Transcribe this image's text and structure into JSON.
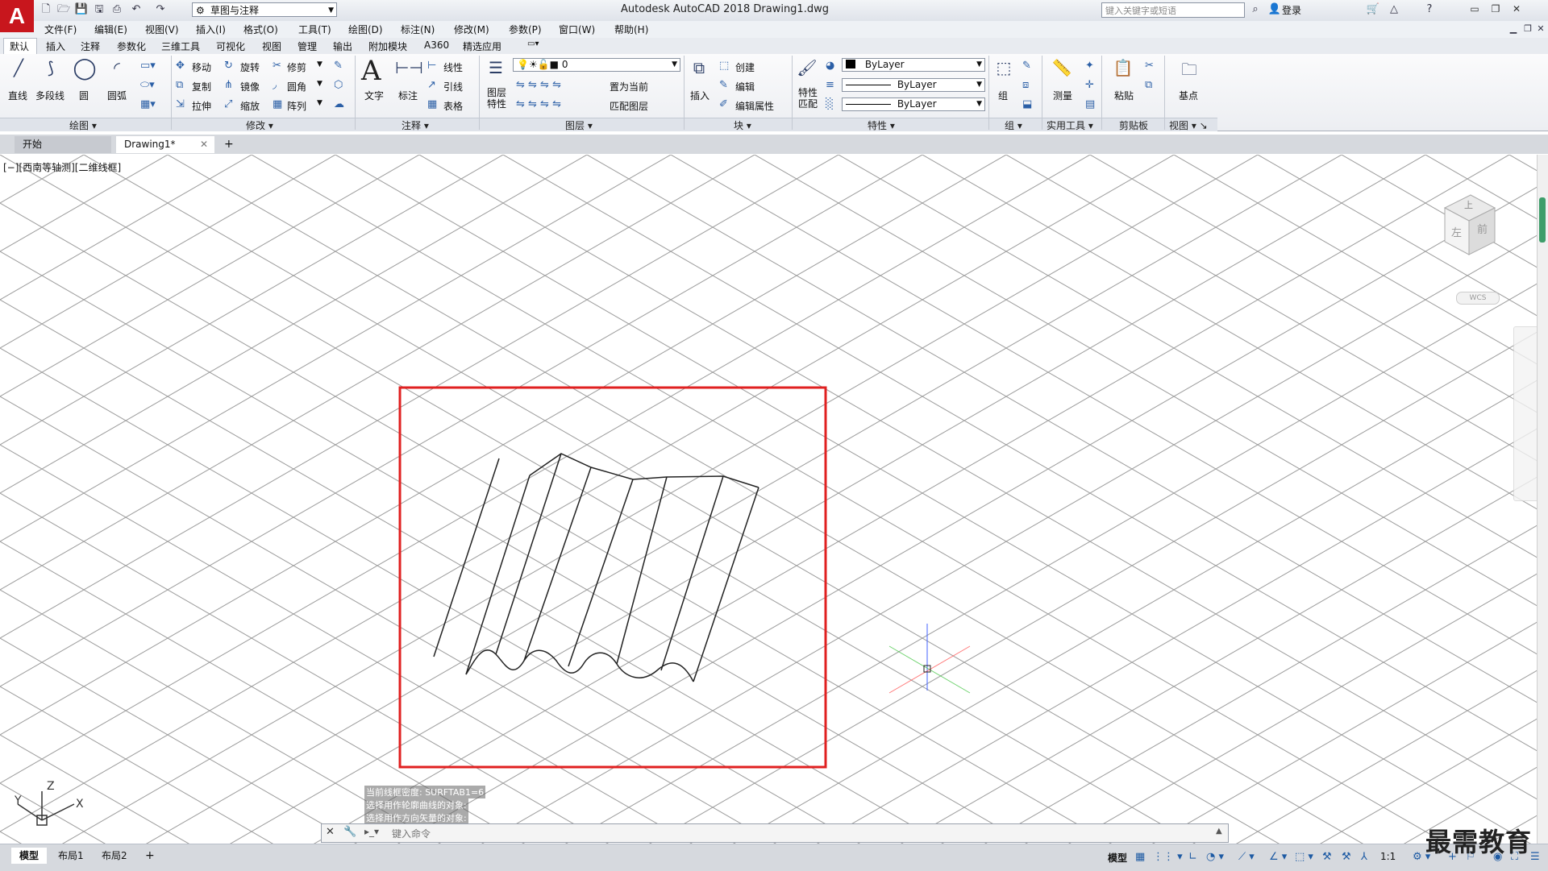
{
  "app": {
    "logo": "A",
    "title": "Autodesk AutoCAD 2018    Drawing1.dwg",
    "workspace": "草图与注释",
    "search_placeholder": "键入关键字或短语",
    "login": "登录"
  },
  "menu": [
    "文件(F)",
    "编辑(E)",
    "视图(V)",
    "插入(I)",
    "格式(O)",
    "工具(T)",
    "绘图(D)",
    "标注(N)",
    "修改(M)",
    "参数(P)",
    "窗口(W)",
    "帮助(H)"
  ],
  "ribbon_tabs": [
    "默认",
    "插入",
    "注释",
    "参数化",
    "三维工具",
    "可视化",
    "视图",
    "管理",
    "输出",
    "附加模块",
    "A360",
    "精选应用"
  ],
  "panels": {
    "draw": {
      "title": "绘图",
      "line": "直线",
      "polyline": "多段线",
      "circle": "圆",
      "arc": "圆弧"
    },
    "modify": {
      "title": "修改",
      "move": "移动",
      "rotate": "旋转",
      "trim": "修剪",
      "copy": "复制",
      "mirror": "镜像",
      "fillet": "圆角",
      "stretch": "拉伸",
      "scale": "缩放",
      "array": "阵列"
    },
    "annotation": {
      "title": "注释",
      "text": "文字",
      "dimension": "标注",
      "linear": "线性",
      "leader": "引线",
      "table": "表格"
    },
    "layers": {
      "title": "图层",
      "properties": "图层\n特性",
      "current_layer": "0",
      "set_current": "置为当前",
      "match": "匹配图层"
    },
    "block": {
      "title": "块",
      "insert": "插入",
      "create": "创建",
      "edit": "编辑",
      "edit_attr": "编辑属性"
    },
    "properties": {
      "title": "特性",
      "match": "特性\n匹配",
      "color": "ByLayer",
      "linetype": "ByLayer",
      "lineweight": "ByLayer"
    },
    "groups": {
      "title": "组",
      "group": "组"
    },
    "utilities": {
      "title": "实用工具",
      "measure": "测量"
    },
    "clipboard": {
      "title": "剪贴板",
      "paste": "粘贴"
    },
    "view": {
      "title": "视图",
      "base": "基点"
    }
  },
  "file_tabs": [
    {
      "label": "开始"
    },
    {
      "label": "Drawing1*"
    }
  ],
  "viewport_label": "[−][西南等轴测][二维线框]",
  "viewcube": {
    "top": "上",
    "front": "前",
    "left": "左",
    "wcs": "WCS"
  },
  "ucs": {
    "x": "X",
    "y": "Y",
    "z": "Z"
  },
  "command_history": [
    "当前线框密度: SURFTAB1=6",
    "选择用作轮廓曲线的对象:",
    "选择用作方向矢量的对象:"
  ],
  "command_placeholder": "键入命令",
  "layout_tabs": [
    "模型",
    "布局1",
    "布局2"
  ],
  "status": {
    "model": "模型",
    "scale": "1:1"
  },
  "watermark": "最需教育",
  "colors": {
    "highlight": "#e02020",
    "accent": "#c8161d"
  }
}
